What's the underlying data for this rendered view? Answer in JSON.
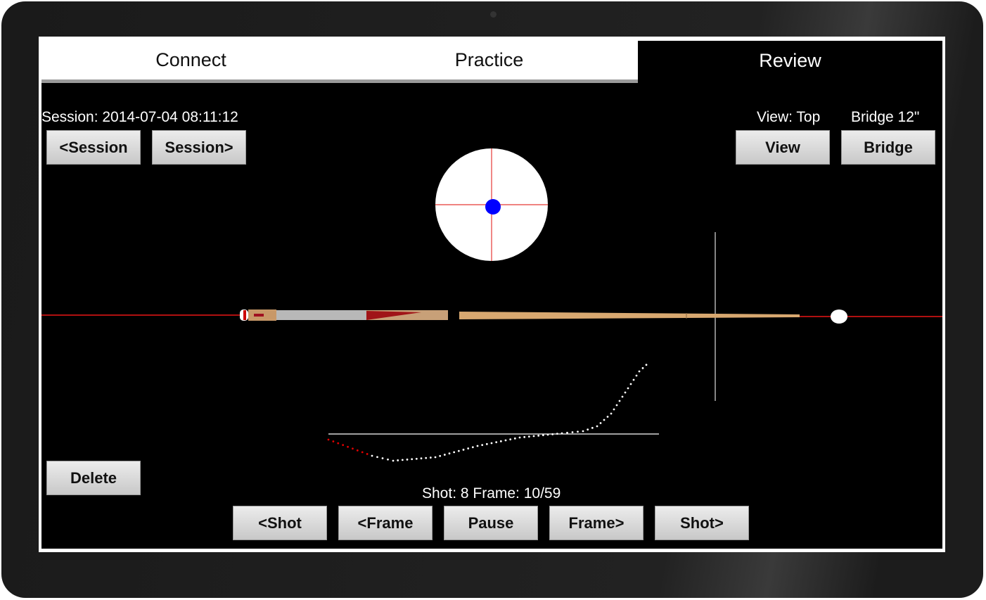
{
  "tabs": [
    {
      "label": "Connect"
    },
    {
      "label": "Practice"
    },
    {
      "label": "Review",
      "active": true
    }
  ],
  "session": {
    "label": "Session: 2014-07-04 08:11:12",
    "prev": "<Session",
    "next": "Session>"
  },
  "view": {
    "label": "View: Top",
    "button": "View"
  },
  "bridge": {
    "label": "Bridge 12\"",
    "button": "Bridge"
  },
  "delete": "Delete",
  "playback": {
    "status": "Shot: 8 Frame: 10/59",
    "prev_shot": "<Shot",
    "prev_frame": "<Frame",
    "pause": "Pause",
    "next_frame": "Frame>",
    "next_shot": "Shot>"
  },
  "colors": {
    "tip_dot": "#0000ff",
    "crosshair": "#e53935",
    "trajectory_start": "#e00000",
    "trajectory": "#ffffff"
  }
}
